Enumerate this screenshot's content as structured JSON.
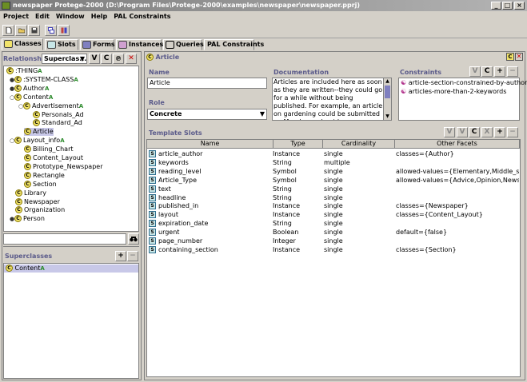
{
  "window": {
    "title": "newspaper Protege-2000   (D:\\Program Files\\Protege-2000\\examples\\newspaper\\newspaper.pprj)",
    "controls": [
      "_",
      "□",
      "×"
    ]
  },
  "menu": [
    "Project",
    "Edit",
    "Window",
    "Help",
    "PAL Constraints"
  ],
  "tabs": [
    {
      "label": "Classes",
      "active": true
    },
    {
      "label": "Slots",
      "active": false
    },
    {
      "label": "Forms",
      "active": false
    },
    {
      "label": "Instances",
      "active": false
    },
    {
      "label": "Queries",
      "active": false
    },
    {
      "label": "PAL Constraints",
      "active": false
    }
  ],
  "left_panel": {
    "relationship_label": "Relationship",
    "relationship_value": "Superclas...",
    "buttons": [
      "V",
      "C"
    ],
    "tree": [
      {
        "label": ":THING",
        "depth": 0,
        "toggle": "",
        "superA": true
      },
      {
        "label": ":SYSTEM-CLASS",
        "depth": 1,
        "toggle": "+",
        "superA": true
      },
      {
        "label": "Author",
        "depth": 1,
        "toggle": "+",
        "superA": true
      },
      {
        "label": "Content",
        "depth": 1,
        "toggle": "-",
        "superA": true
      },
      {
        "label": "Advertisement",
        "depth": 2,
        "toggle": "-",
        "superA": true
      },
      {
        "label": "Personals_Ad",
        "depth": 3,
        "toggle": "",
        "superA": false
      },
      {
        "label": "Standard_Ad",
        "depth": 3,
        "toggle": "",
        "superA": false
      },
      {
        "label": "Article",
        "depth": 2,
        "toggle": "",
        "superA": false,
        "selected": true
      },
      {
        "label": "Layout_info",
        "depth": 1,
        "toggle": "-",
        "superA": true
      },
      {
        "label": "Billing_Chart",
        "depth": 2,
        "toggle": "",
        "superA": false
      },
      {
        "label": "Content_Layout",
        "depth": 2,
        "toggle": "",
        "superA": false
      },
      {
        "label": "Prototype_Newspaper",
        "depth": 2,
        "toggle": "",
        "superA": false
      },
      {
        "label": "Rectangle",
        "depth": 2,
        "toggle": "",
        "superA": false
      },
      {
        "label": "Section",
        "depth": 2,
        "toggle": "",
        "superA": false
      },
      {
        "label": "Library",
        "depth": 1,
        "toggle": "",
        "superA": false
      },
      {
        "label": "Newspaper",
        "depth": 1,
        "toggle": "",
        "superA": false
      },
      {
        "label": "Organization",
        "depth": 1,
        "toggle": "",
        "superA": false
      },
      {
        "label": "Person",
        "depth": 1,
        "toggle": "+",
        "superA": false
      }
    ],
    "search_value": "",
    "superclasses_label": "Superclasses",
    "superclasses_buttons": [
      "+",
      "−"
    ],
    "superclasses": [
      {
        "label": "Content",
        "superA": true
      }
    ]
  },
  "right_panel": {
    "class_header": "Article",
    "name_label": "Name",
    "name_value": "Article",
    "documentation_label": "Documentation",
    "documentation_text": "Articles are included here as soon as they are written--they could go for a while without being published. For example, an article on gardening could be submitted on Monday and not be",
    "constraints_label": "Constraints",
    "constraints_buttons": [
      "V",
      "C",
      "+",
      "−"
    ],
    "constraints": [
      "article-section-constrained-by-author",
      "articles-more-than-2-keywords"
    ],
    "role_label": "Role",
    "role_value": "Concrete",
    "template_slots_label": "Template Slots",
    "slots_buttons": [
      "V",
      "V",
      "C",
      "X",
      "+",
      "−"
    ],
    "columns": [
      "Name",
      "Type",
      "Cardinality",
      "Other Facets"
    ],
    "slots": [
      {
        "name": "article_author",
        "type": "Instance",
        "cardinality": "single",
        "facets": "classes={Author}",
        "kind": "S"
      },
      {
        "name": "keywords",
        "type": "String",
        "cardinality": "multiple",
        "facets": "",
        "kind": "S"
      },
      {
        "name": "reading_level",
        "type": "Symbol",
        "cardinality": "single",
        "facets": "allowed-values={Elementary,Middle_scho...",
        "kind": "S"
      },
      {
        "name": "Article_Type",
        "type": "Symbol",
        "cardinality": "single",
        "facets": "allowed-values={Advice,Opinion,News}",
        "kind": "S"
      },
      {
        "name": "text",
        "type": "String",
        "cardinality": "single",
        "facets": "",
        "kind": "S"
      },
      {
        "name": "headline",
        "type": "String",
        "cardinality": "single",
        "facets": "",
        "kind": "S"
      },
      {
        "name": "published_in",
        "type": "Instance",
        "cardinality": "single",
        "facets": "classes={Newspaper}",
        "kind": "S"
      },
      {
        "name": "layout",
        "type": "Instance",
        "cardinality": "single",
        "facets": "classes={Content_Layout}",
        "kind": "S"
      },
      {
        "name": "expiration_date",
        "type": "String",
        "cardinality": "single",
        "facets": "",
        "kind": "S"
      },
      {
        "name": "urgent",
        "type": "Boolean",
        "cardinality": "single",
        "facets": "default={false}",
        "kind": "S"
      },
      {
        "name": "page_number",
        "type": "Integer",
        "cardinality": "single",
        "facets": "",
        "kind": "S"
      },
      {
        "name": "containing_section",
        "type": "Instance",
        "cardinality": "single",
        "facets": "classes={Section}",
        "kind": "S"
      }
    ]
  },
  "colors": {
    "window_bg": "#d4d0c8",
    "header_text": "#5a5a8a",
    "selection": "#c8c8e8",
    "class_badge": "#f1e36a",
    "slot_badge": "#c8e6e6",
    "superA": "#2a8a2a"
  }
}
